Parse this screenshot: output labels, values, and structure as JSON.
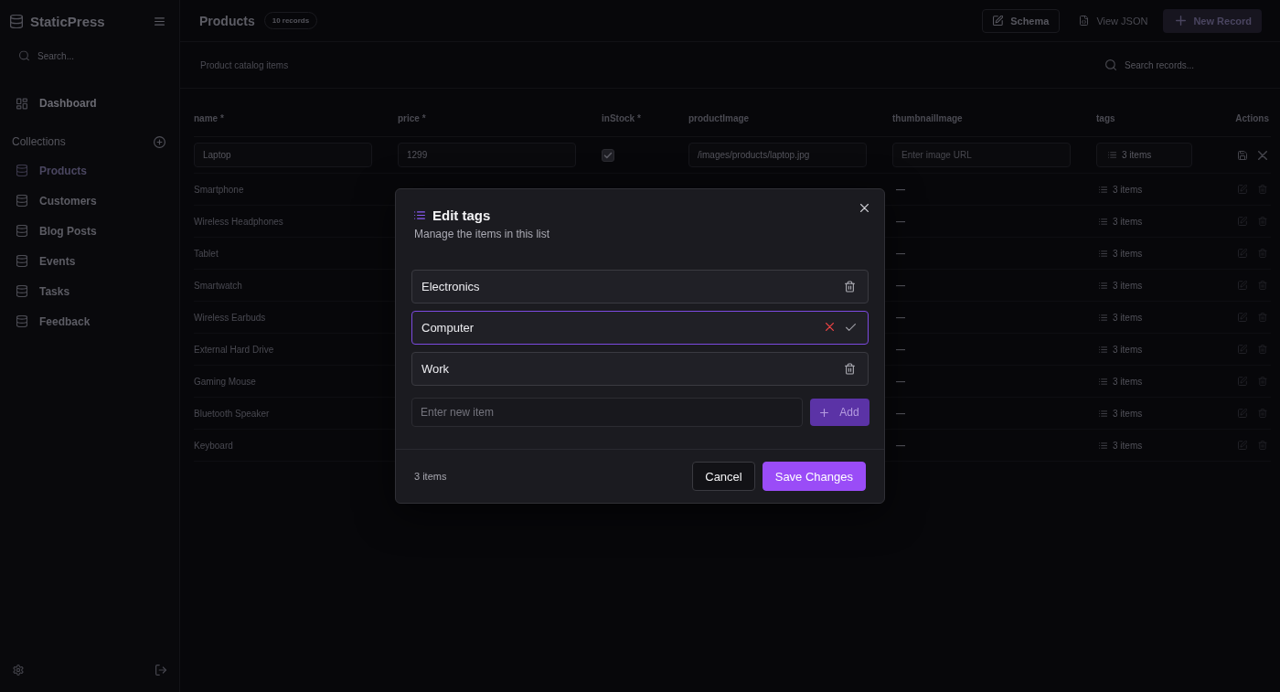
{
  "sidebar": {
    "brand": "StaticPress",
    "search": {
      "placeholder": "Search..."
    },
    "nav": [
      {
        "label": "Dashboard",
        "selected": false
      }
    ],
    "collections_heading": "Collections",
    "collections": [
      {
        "label": "Products",
        "selected": true
      },
      {
        "label": "Customers",
        "selected": false
      },
      {
        "label": "Blog Posts",
        "selected": false
      },
      {
        "label": "Events",
        "selected": false
      },
      {
        "label": "Tasks",
        "selected": false
      },
      {
        "label": "Feedback",
        "selected": false
      }
    ]
  },
  "header": {
    "title": "Products",
    "badge": "10 records",
    "actions": [
      {
        "label": "Schema",
        "kind": "outline"
      },
      {
        "label": "View JSON",
        "kind": "ghost"
      },
      {
        "label": "New Record",
        "kind": "primary"
      }
    ]
  },
  "toolbar": {
    "description": "Product catalog items",
    "search": {
      "placeholder": "Search records..."
    }
  },
  "table": {
    "columns": [
      {
        "label": "name",
        "marker": "*"
      },
      {
        "label": "price",
        "marker": "*"
      },
      {
        "label": "inStock",
        "marker": "*"
      },
      {
        "label": "productImage"
      },
      {
        "label": "thumbnailImage"
      },
      {
        "label": "tags"
      },
      {
        "label": "Actions"
      }
    ],
    "editing_row": {
      "name": "Laptop",
      "price": "1299",
      "in_stock": true,
      "product_image": "/images/products/laptop.jpg",
      "thumbnail_image": {
        "placeholder": "Enter image URL"
      },
      "tags": "3 items"
    },
    "rows": [
      {
        "name": "Smartphone",
        "thumbnail_image": "—",
        "tags": "3 items"
      },
      {
        "name": "Wireless Headphones",
        "thumbnail_image": "—",
        "tags": "3 items"
      },
      {
        "name": "Tablet",
        "thumbnail_image": "—",
        "tags": "3 items"
      },
      {
        "name": "Smartwatch",
        "thumbnail_image": "—",
        "tags": "3 items"
      },
      {
        "name": "Wireless Earbuds",
        "thumbnail_image": "—",
        "tags": "3 items"
      },
      {
        "name": "External Hard Drive",
        "thumbnail_image": "—",
        "tags": "3 items"
      },
      {
        "name": "Gaming Mouse",
        "thumbnail_image": "—",
        "tags": "3 items"
      },
      {
        "name": "Bluetooth Speaker",
        "thumbnail_image": "—",
        "tags": "3 items"
      },
      {
        "name": "Keyboard",
        "thumbnail_image": "—",
        "tags": "3 items"
      }
    ]
  },
  "modal": {
    "title": "Edit tags",
    "subtitle": "Manage the items in this list",
    "items": [
      {
        "value": "Electronics",
        "editing": false
      },
      {
        "value": "Computer",
        "editing": true
      },
      {
        "value": "Work",
        "editing": false
      }
    ],
    "new_item": {
      "placeholder": "Enter new item"
    },
    "add_button": {
      "label": "Add",
      "disabled": true
    },
    "count": "3 items",
    "buttons": [
      {
        "label": "Cancel",
        "kind": "secondary"
      },
      {
        "label": "Save Changes",
        "kind": "primary"
      }
    ]
  }
}
